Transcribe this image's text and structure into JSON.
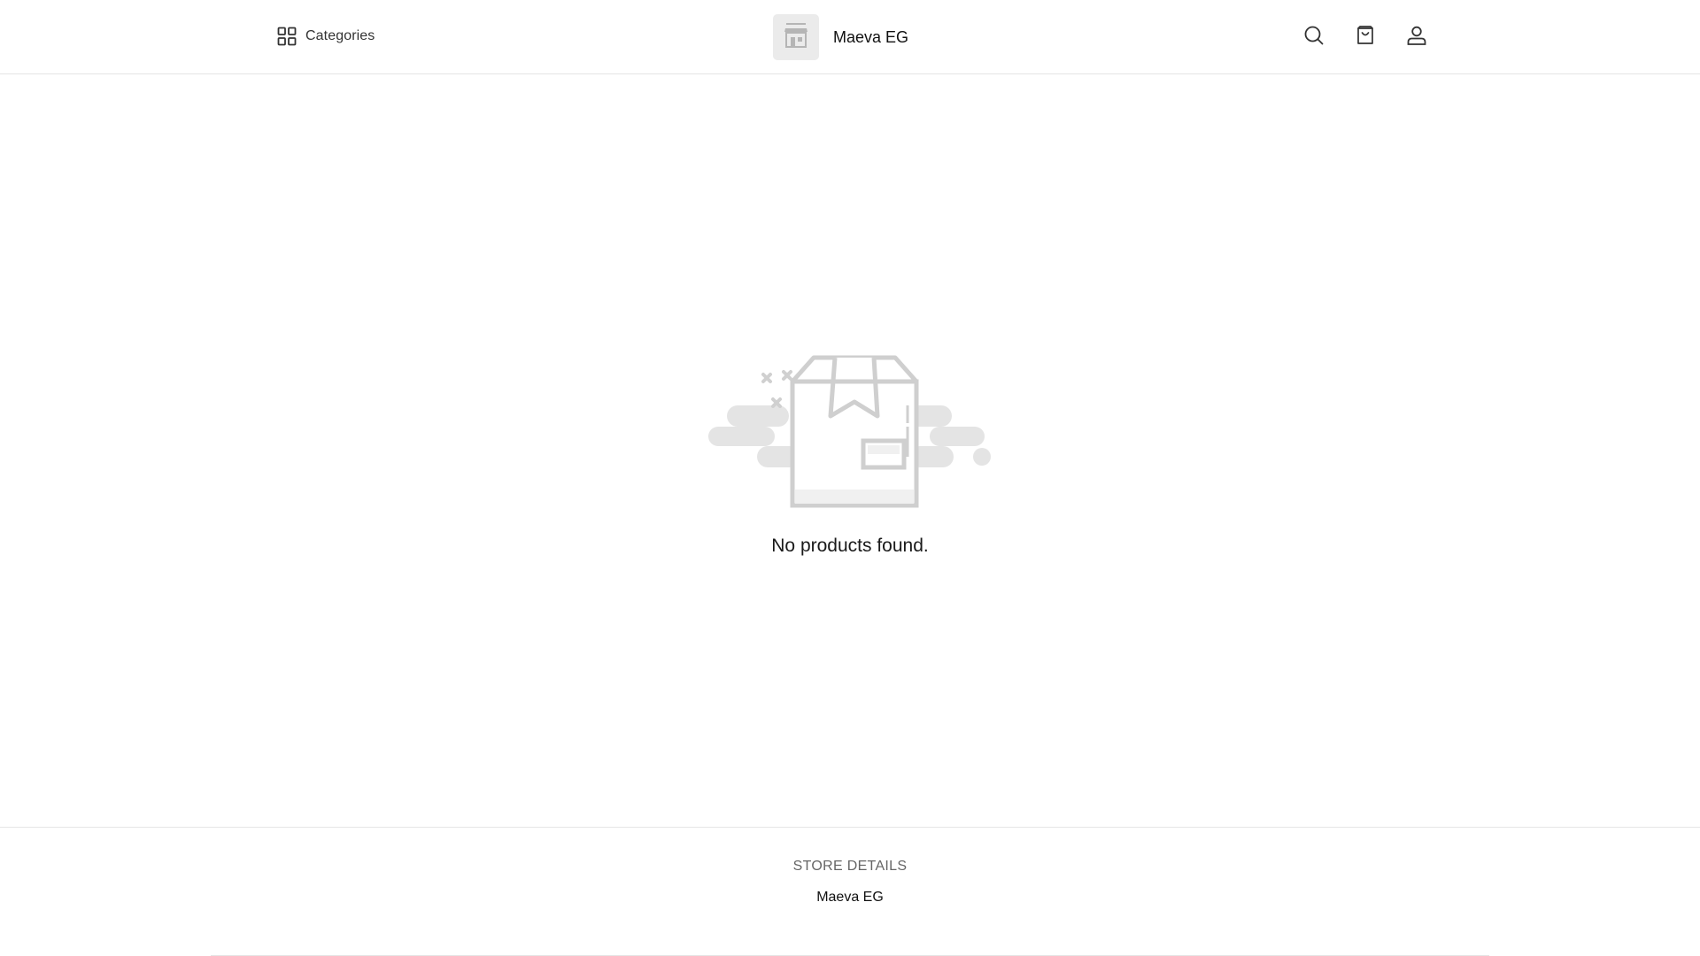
{
  "header": {
    "categories_label": "Categories",
    "store_name": "Maeva EG",
    "icons": [
      "grid-icon",
      "store-icon",
      "search-icon",
      "shopping-bag-icon",
      "user-icon"
    ]
  },
  "main": {
    "empty_message": "No products found.",
    "illustration": "empty-box-icon"
  },
  "footer": {
    "heading": "STORE DETAILS",
    "store_name": "Maeva EG"
  },
  "colors": {
    "background": "#ffffff",
    "border": "#e5e5e5",
    "text_primary": "#1a1a1a",
    "text_muted": "#666666",
    "illustration_gray": "#d9d9d9"
  }
}
